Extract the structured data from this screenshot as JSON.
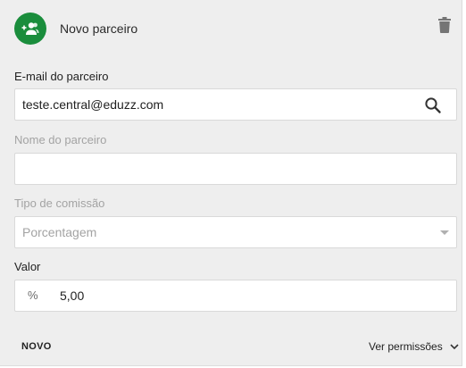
{
  "header": {
    "title": "Novo parceiro",
    "avatar_icon": "add-partner-icon",
    "delete_icon": "trash-icon"
  },
  "email": {
    "label": "E-mail do parceiro",
    "value": "teste.central@eduzz.com",
    "search_icon": "search-icon"
  },
  "nome": {
    "label": "Nome do parceiro",
    "value": ""
  },
  "comissao": {
    "label": "Tipo de comissão",
    "selected": "Porcentagem"
  },
  "valor": {
    "label": "Valor",
    "prefix": "%",
    "value": "5,00"
  },
  "footer": {
    "novo_label": "NOVO",
    "permissions_label": "Ver permissões"
  },
  "colors": {
    "accent": "#1a8d3c",
    "background": "#eeeeee"
  }
}
